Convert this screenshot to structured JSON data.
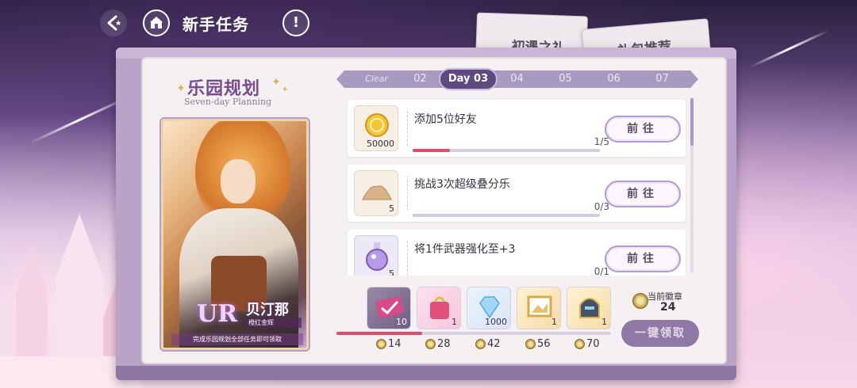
{
  "header": {
    "title": "新手任务",
    "info_symbol": "!"
  },
  "side_tabs": [
    {
      "label": "初遇之礼"
    },
    {
      "label": "礼包推荐"
    }
  ],
  "plan": {
    "title": "乐园规划",
    "subtitle": "Seven-day Planning"
  },
  "hero": {
    "rank": "UR",
    "name": "贝汀那",
    "subtitle": "橙红金辉",
    "note": "完成乐园规划全部任务即可领取"
  },
  "days": {
    "clear_label": "Clear",
    "items": [
      "02",
      "Day 03",
      "04",
      "05",
      "06",
      "07"
    ],
    "active_index": 1
  },
  "tasks": [
    {
      "description": "添加5位好友",
      "reward_qty": "50000",
      "progress_text": "1/5",
      "progress": 0.2,
      "button": "前往",
      "icon": "gold-coin-icon"
    },
    {
      "description": "挑战3次超级叠分乐",
      "reward_qty": "5",
      "progress_text": "0/3",
      "progress": 0,
      "button": "前往",
      "icon": "sand-pile-icon"
    },
    {
      "description": "将1件武器强化至+3",
      "reward_qty": "5",
      "progress_text": "0/1",
      "progress": 0,
      "button": "前往",
      "icon": "potion-bottle-icon"
    }
  ],
  "rewards": [
    {
      "qty": "10",
      "icon": "ticket-check-icon",
      "claimed": true
    },
    {
      "qty": "1",
      "icon": "gift-bag-icon"
    },
    {
      "qty": "1000",
      "icon": "diamond-icon"
    },
    {
      "qty": "1",
      "icon": "picture-frame-icon"
    },
    {
      "qty": "1",
      "icon": "helmet-icon"
    }
  ],
  "milestones": [
    "14",
    "28",
    "42",
    "56",
    "70"
  ],
  "medal_progress": 24,
  "current": {
    "label": "当前徽章",
    "count": "24"
  },
  "claim_all_label": "一键领取",
  "colors": {
    "accent": "#e04a6d",
    "frame": "#b9a3c6",
    "active_day": "#5c4a80"
  }
}
